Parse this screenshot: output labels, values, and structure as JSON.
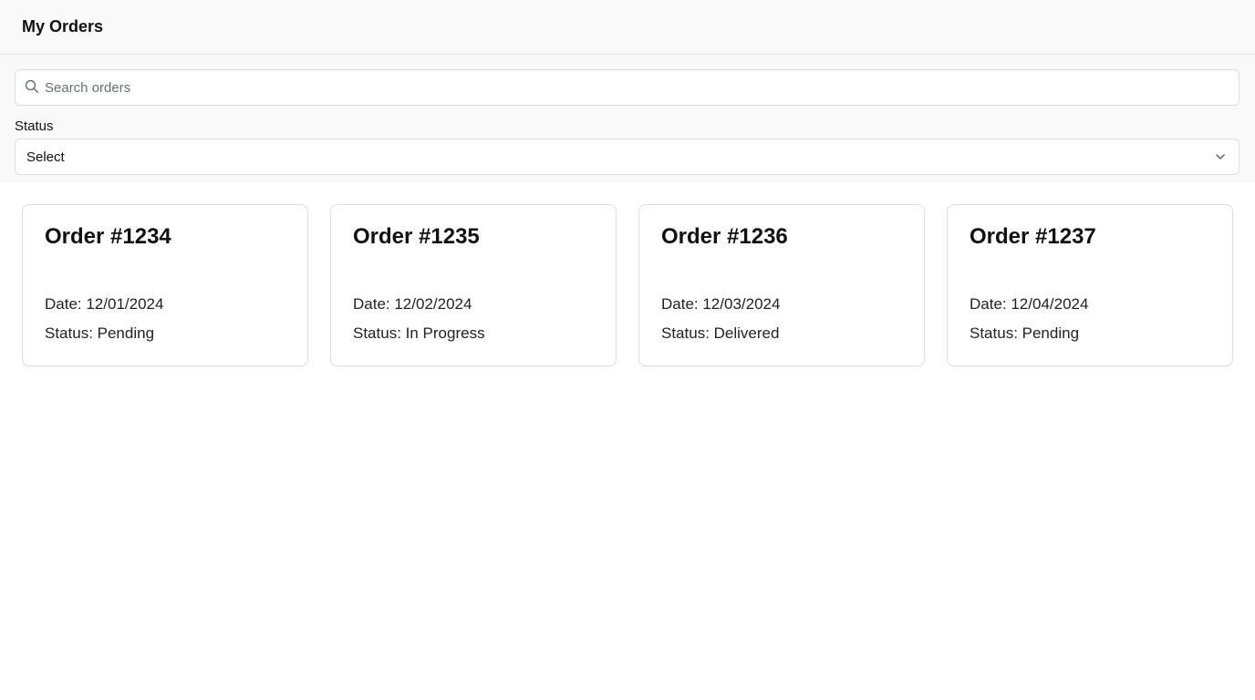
{
  "header": {
    "title": "My Orders"
  },
  "search": {
    "placeholder": "Search orders",
    "value": ""
  },
  "status_filter": {
    "label": "Status",
    "selected": "Select"
  },
  "orders": [
    {
      "title": "Order #1234",
      "date": "Date: 12/01/2024",
      "status": "Status: Pending"
    },
    {
      "title": "Order #1235",
      "date": "Date: 12/02/2024",
      "status": "Status: In Progress"
    },
    {
      "title": "Order #1236",
      "date": "Date: 12/03/2024",
      "status": "Status: Delivered"
    },
    {
      "title": "Order #1237",
      "date": "Date: 12/04/2024",
      "status": "Status: Pending"
    }
  ],
  "icons": {
    "search": "search-icon",
    "select_chevron": "chevron-down-icon"
  },
  "colors": {
    "header_background": "#f8f9f8",
    "border": "#dcdfdc",
    "text": "#111111",
    "placeholder": "#6b6f6b"
  }
}
